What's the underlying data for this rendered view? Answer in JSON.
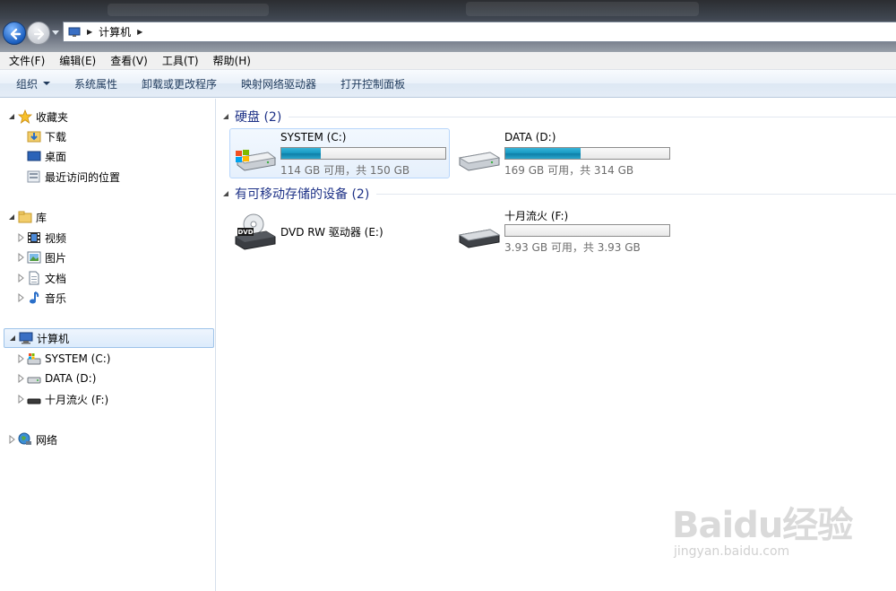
{
  "address": {
    "crumbs": [
      "计算机"
    ]
  },
  "menubar": {
    "items": [
      "文件(F)",
      "编辑(E)",
      "查看(V)",
      "工具(T)",
      "帮助(H)"
    ]
  },
  "commandbar": {
    "organize": "组织",
    "items": [
      "系统属性",
      "卸载或更改程序",
      "映射网络驱动器",
      "打开控制面板"
    ]
  },
  "navpane": {
    "favorites": {
      "label": "收藏夹",
      "items": [
        "下载",
        "桌面",
        "最近访问的位置"
      ]
    },
    "libraries": {
      "label": "库",
      "items": [
        "视频",
        "图片",
        "文档",
        "音乐"
      ]
    },
    "computer": {
      "label": "计算机",
      "items": [
        "SYSTEM (C:)",
        "DATA (D:)",
        "十月流火 (F:)"
      ]
    },
    "network": {
      "label": "网络"
    }
  },
  "content": {
    "hdd_group": {
      "title": "硬盘 (2)"
    },
    "removable_group": {
      "title": "有可移动存储的设备 (2)"
    },
    "drives": {
      "c": {
        "name": "SYSTEM (C:)",
        "info": "114 GB 可用，共 150 GB",
        "used_fraction": 0.24
      },
      "d": {
        "name": "DATA (D:)",
        "info": "169 GB 可用，共 314 GB",
        "used_fraction": 0.46
      },
      "e": {
        "name": "DVD RW 驱动器 (E:)"
      },
      "f": {
        "name": "十月流火 (F:)",
        "info": "3.93 GB 可用，共 3.93 GB",
        "used_fraction": 0.0
      }
    }
  },
  "watermark": {
    "text": "Baidu经验",
    "url": "jingyan.baidu.com"
  },
  "colors": {
    "accent": "#1e3287",
    "bar_fill": "#1a9cc4",
    "selection": "#dcebfc"
  }
}
